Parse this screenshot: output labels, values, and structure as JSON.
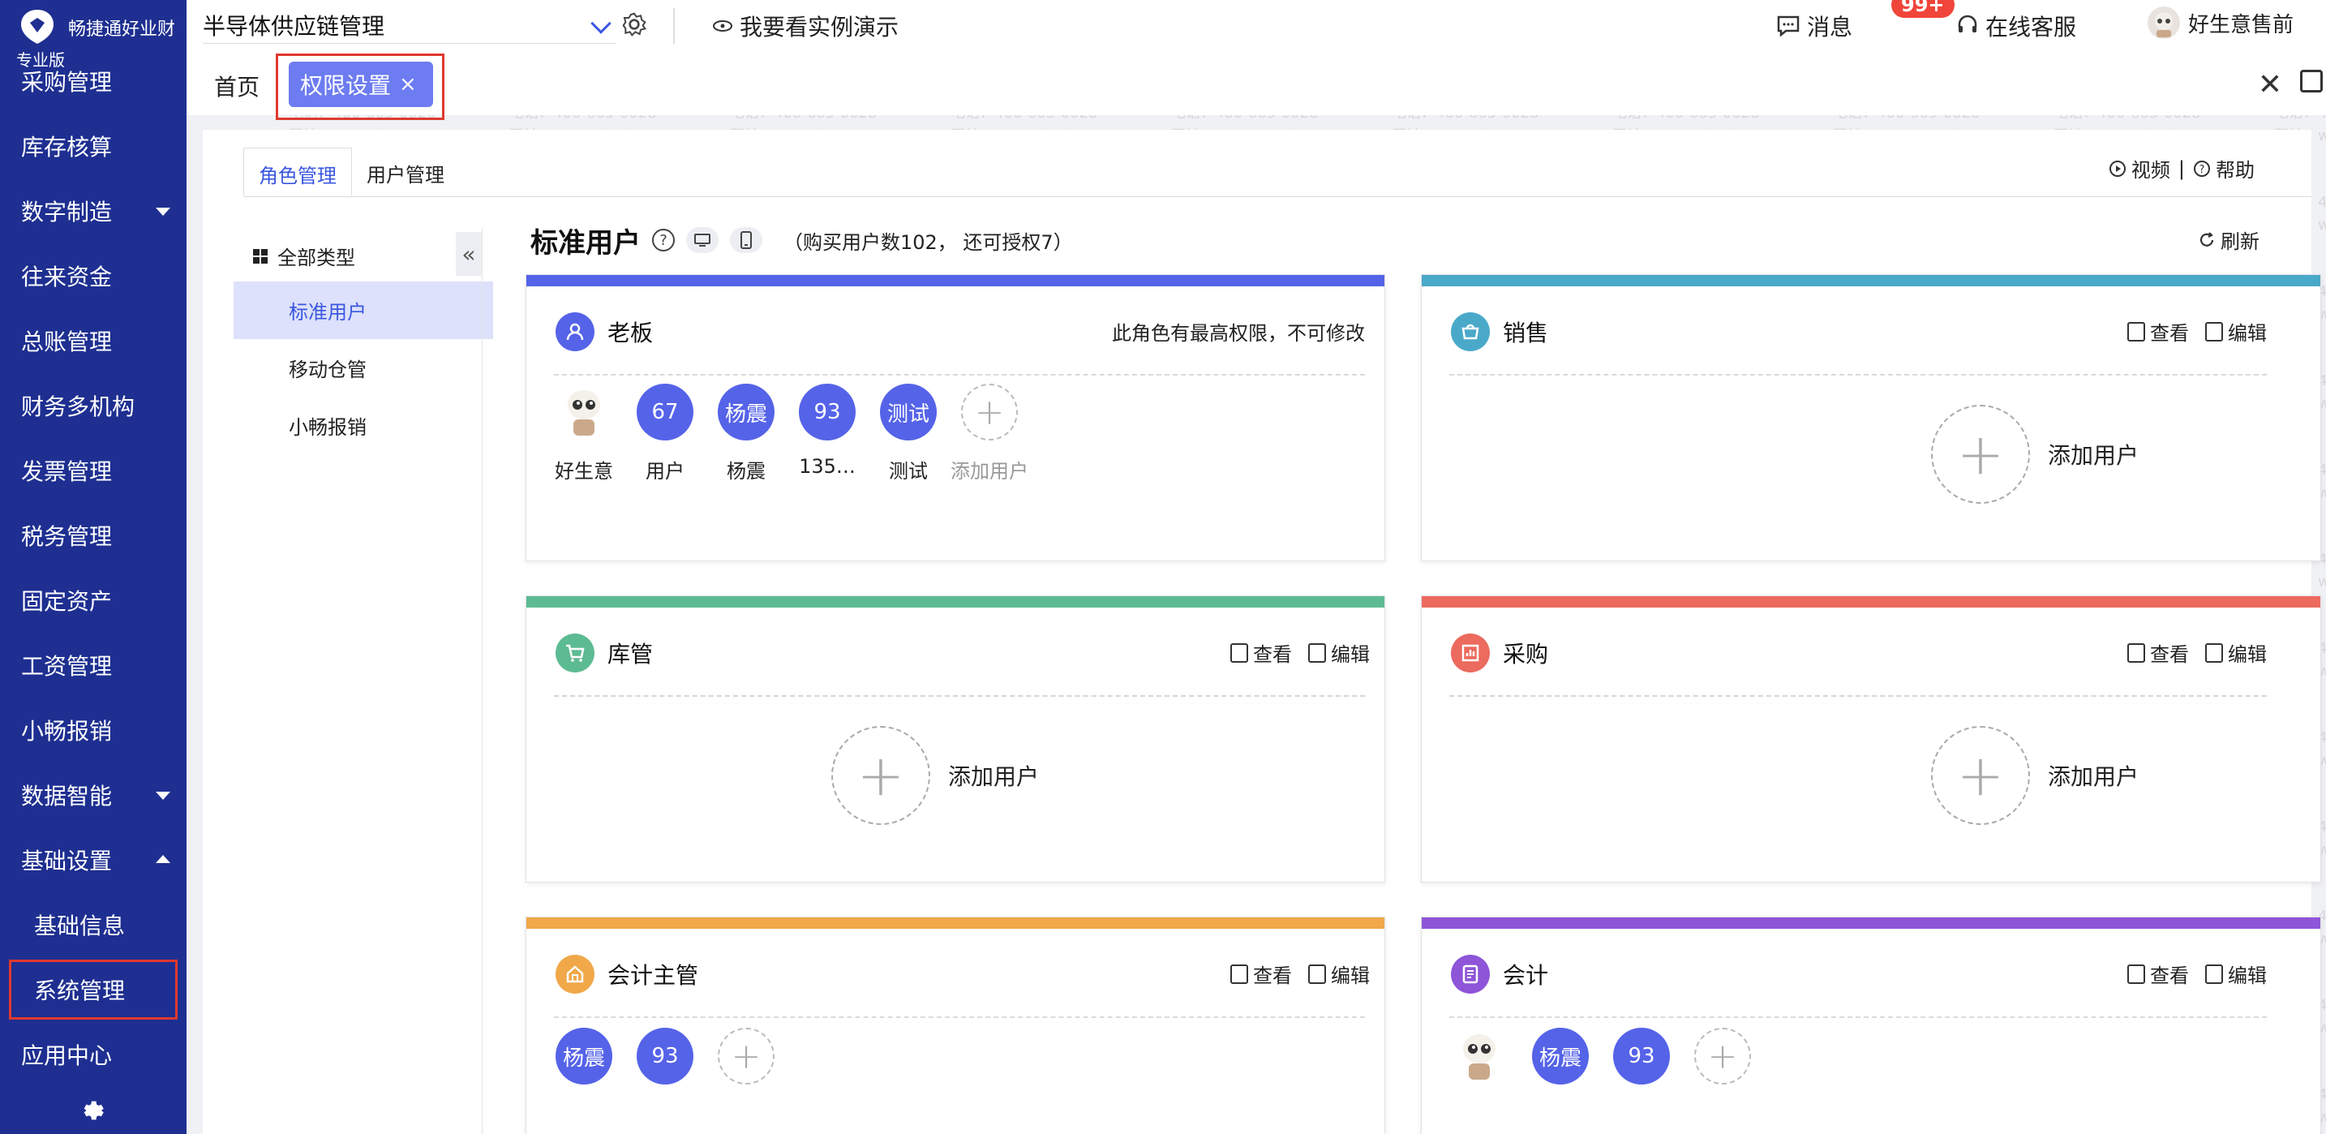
{
  "brand": {
    "name": "畅捷通好业财",
    "edition": "专业版"
  },
  "sidebar": {
    "items": [
      {
        "label": "采购管理",
        "sub": false,
        "arrow": ""
      },
      {
        "label": "库存核算",
        "sub": false,
        "arrow": ""
      },
      {
        "label": "数字制造",
        "sub": false,
        "arrow": "down"
      },
      {
        "label": "往来资金",
        "sub": false,
        "arrow": ""
      },
      {
        "label": "总账管理",
        "sub": false,
        "arrow": ""
      },
      {
        "label": "财务多机构",
        "sub": false,
        "arrow": ""
      },
      {
        "label": "发票管理",
        "sub": false,
        "arrow": ""
      },
      {
        "label": "税务管理",
        "sub": false,
        "arrow": ""
      },
      {
        "label": "固定资产",
        "sub": false,
        "arrow": ""
      },
      {
        "label": "工资管理",
        "sub": false,
        "arrow": ""
      },
      {
        "label": "小畅报销",
        "sub": false,
        "arrow": ""
      },
      {
        "label": "数据智能",
        "sub": false,
        "arrow": "down"
      },
      {
        "label": "基础设置",
        "sub": false,
        "arrow": "up"
      },
      {
        "label": "基础信息",
        "sub": true,
        "arrow": ""
      },
      {
        "label": "系统管理",
        "sub": true,
        "arrow": "",
        "highlight": true
      },
      {
        "label": "应用中心",
        "sub": false,
        "arrow": ""
      }
    ]
  },
  "topbar": {
    "company": "半导体供应链管理",
    "demo": "我要看实例演示",
    "messages": "消息",
    "messages_badge": "99+",
    "service": "在线客服",
    "user": "好生意售前"
  },
  "tabs": {
    "home": "首页",
    "active": "权限设置",
    "close": "×"
  },
  "subtabs": [
    "角色管理",
    "用户管理"
  ],
  "help": {
    "video": "视频",
    "sep": "|",
    "help": "帮助"
  },
  "tree": {
    "head": "全部类型",
    "items": [
      "标准用户",
      "移动仓管",
      "小畅报销"
    ],
    "collapse": "«"
  },
  "content": {
    "title": "标准用户",
    "purchase_info": "（购买用户数102，  还可授权7）",
    "refresh": "刷新"
  },
  "actions": {
    "view": "查看",
    "edit": "编辑",
    "add_user": "添加用户"
  },
  "roles": {
    "boss": {
      "name": "老板",
      "note": "此角色有最高权限，不可修改",
      "color": "#5563e8",
      "users": [
        {
          "circle": "",
          "label": "好生意",
          "robot": true
        },
        {
          "circle": "67",
          "label": "用户"
        },
        {
          "circle": "杨震",
          "label": "杨震"
        },
        {
          "circle": "93",
          "label": "135…"
        },
        {
          "circle": "测试",
          "label": "测试"
        }
      ]
    },
    "sales": {
      "name": "销售",
      "color": "#4aa9c9"
    },
    "warehouse": {
      "name": "库管",
      "color": "#5dbb93"
    },
    "purchase": {
      "name": "采购",
      "color": "#ec6a5e"
    },
    "accounting_mgr": {
      "name": "会计主管",
      "color": "#f0a849",
      "users": [
        {
          "circle": "杨震"
        },
        {
          "circle": "93"
        }
      ]
    },
    "accountant": {
      "name": "会计",
      "color": "#8e55d8",
      "users": [
        {
          "circle": "",
          "robot": true
        },
        {
          "circle": "杨震"
        },
        {
          "circle": "93"
        }
      ]
    }
  },
  "watermark": {
    "line1": "电话：400-665-0028",
    "line2": "网址：www.chanjet.net"
  }
}
